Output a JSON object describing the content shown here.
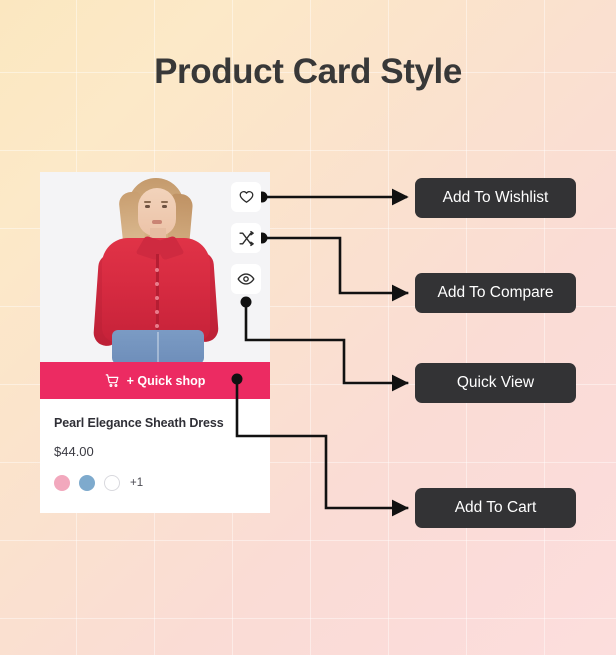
{
  "page": {
    "title": "Product Card Style",
    "background_start": "#fbe7c0",
    "background_end": "#fcdedd"
  },
  "card": {
    "product_name": "Pearl Elegance Sheath Dress",
    "price": "$44.00",
    "quick_shop_label": "+ Quick shop",
    "quick_shop_color": "#ec2b62",
    "cart_icon": "shopping-cart-icon",
    "swatches": [
      {
        "name": "pink",
        "color": "#f2a8bd"
      },
      {
        "name": "blue",
        "color": "#7eaacd"
      },
      {
        "name": "white",
        "color": "#ffffff"
      }
    ],
    "swatch_more": "+1",
    "actions": [
      {
        "name": "wishlist",
        "icon": "heart-icon"
      },
      {
        "name": "compare",
        "icon": "shuffle-icon"
      },
      {
        "name": "quickview",
        "icon": "eye-icon"
      }
    ]
  },
  "labels": {
    "wishlist": "Add To Wishlist",
    "compare": "Add To Compare",
    "quickview": "Quick View",
    "cart": "Add To Cart",
    "box_color": "#333335",
    "text_color": "#ffffff"
  },
  "connectors": {
    "stroke_color": "#111111",
    "items": [
      {
        "from": "wishlist-icon",
        "to": "Add To Wishlist"
      },
      {
        "from": "compare-icon",
        "to": "Add To Compare"
      },
      {
        "from": "quickview-icon",
        "to": "Quick View"
      },
      {
        "from": "quick-shop-bar",
        "to": "Add To Cart"
      }
    ]
  }
}
